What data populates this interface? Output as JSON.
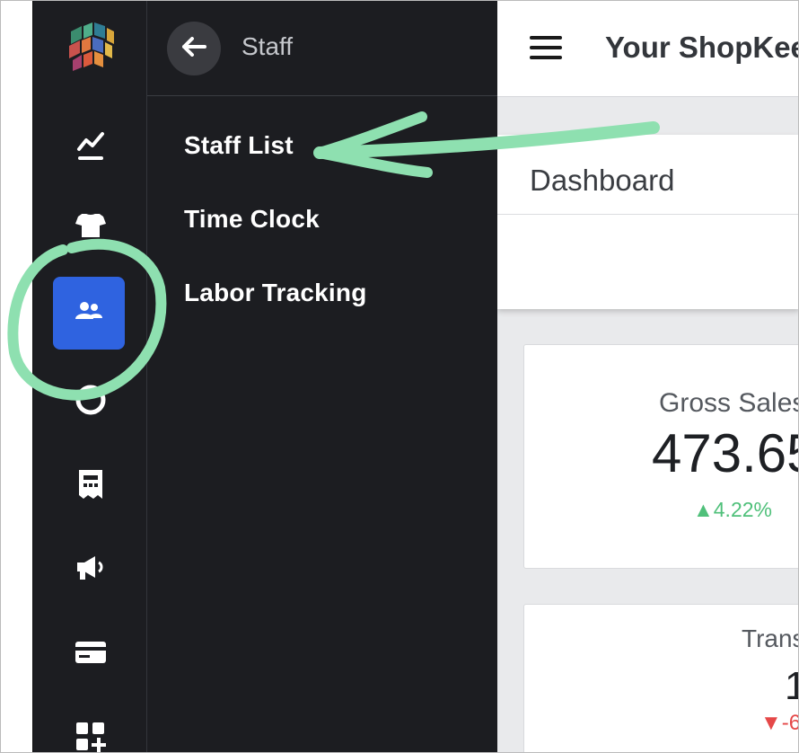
{
  "sidebar": {
    "icons": [
      "logo-icon",
      "analytics-icon",
      "tshirt-icon",
      "staff-icon",
      "customers-icon",
      "receipt-icon",
      "marketing-icon",
      "payments-icon",
      "add-apps-icon"
    ],
    "active": "staff-icon"
  },
  "submenu": {
    "title": "Staff",
    "items": [
      {
        "label": "Staff List"
      },
      {
        "label": "Time Clock"
      },
      {
        "label": "Labor Tracking"
      }
    ]
  },
  "header": {
    "title": "Your ShopKee"
  },
  "dashboard": {
    "title": "Dashboard"
  },
  "stats": [
    {
      "label": "Gross Sales",
      "value": "473.65",
      "delta": "▲4.22%"
    },
    {
      "label": "Trans",
      "value": "1",
      "delta": "▼-6"
    }
  ],
  "colors": {
    "rail_bg": "#1c1d21",
    "active_bg": "#2f63e0",
    "annotation": "#8ee0b0",
    "positive": "#4fc07a",
    "negative": "#e54848"
  }
}
